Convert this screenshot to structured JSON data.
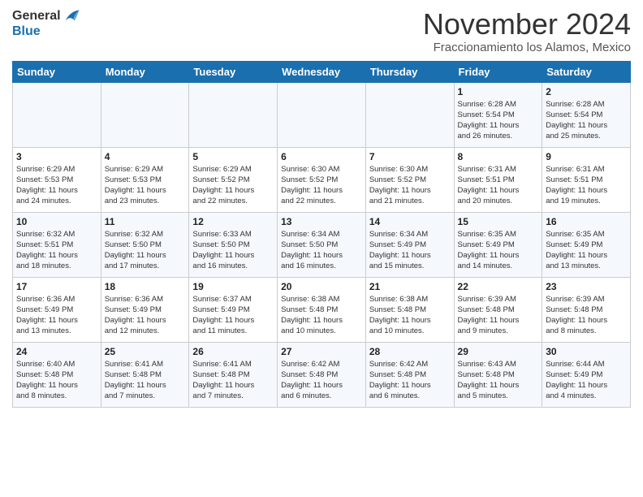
{
  "logo": {
    "general": "General",
    "blue": "Blue"
  },
  "header": {
    "month": "November 2024",
    "location": "Fraccionamiento los Alamos, Mexico"
  },
  "weekdays": [
    "Sunday",
    "Monday",
    "Tuesday",
    "Wednesday",
    "Thursday",
    "Friday",
    "Saturday"
  ],
  "weeks": [
    [
      {
        "day": "",
        "info": ""
      },
      {
        "day": "",
        "info": ""
      },
      {
        "day": "",
        "info": ""
      },
      {
        "day": "",
        "info": ""
      },
      {
        "day": "",
        "info": ""
      },
      {
        "day": "1",
        "info": "Sunrise: 6:28 AM\nSunset: 5:54 PM\nDaylight: 11 hours\nand 26 minutes."
      },
      {
        "day": "2",
        "info": "Sunrise: 6:28 AM\nSunset: 5:54 PM\nDaylight: 11 hours\nand 25 minutes."
      }
    ],
    [
      {
        "day": "3",
        "info": "Sunrise: 6:29 AM\nSunset: 5:53 PM\nDaylight: 11 hours\nand 24 minutes."
      },
      {
        "day": "4",
        "info": "Sunrise: 6:29 AM\nSunset: 5:53 PM\nDaylight: 11 hours\nand 23 minutes."
      },
      {
        "day": "5",
        "info": "Sunrise: 6:29 AM\nSunset: 5:52 PM\nDaylight: 11 hours\nand 22 minutes."
      },
      {
        "day": "6",
        "info": "Sunrise: 6:30 AM\nSunset: 5:52 PM\nDaylight: 11 hours\nand 22 minutes."
      },
      {
        "day": "7",
        "info": "Sunrise: 6:30 AM\nSunset: 5:52 PM\nDaylight: 11 hours\nand 21 minutes."
      },
      {
        "day": "8",
        "info": "Sunrise: 6:31 AM\nSunset: 5:51 PM\nDaylight: 11 hours\nand 20 minutes."
      },
      {
        "day": "9",
        "info": "Sunrise: 6:31 AM\nSunset: 5:51 PM\nDaylight: 11 hours\nand 19 minutes."
      }
    ],
    [
      {
        "day": "10",
        "info": "Sunrise: 6:32 AM\nSunset: 5:51 PM\nDaylight: 11 hours\nand 18 minutes."
      },
      {
        "day": "11",
        "info": "Sunrise: 6:32 AM\nSunset: 5:50 PM\nDaylight: 11 hours\nand 17 minutes."
      },
      {
        "day": "12",
        "info": "Sunrise: 6:33 AM\nSunset: 5:50 PM\nDaylight: 11 hours\nand 16 minutes."
      },
      {
        "day": "13",
        "info": "Sunrise: 6:34 AM\nSunset: 5:50 PM\nDaylight: 11 hours\nand 16 minutes."
      },
      {
        "day": "14",
        "info": "Sunrise: 6:34 AM\nSunset: 5:49 PM\nDaylight: 11 hours\nand 15 minutes."
      },
      {
        "day": "15",
        "info": "Sunrise: 6:35 AM\nSunset: 5:49 PM\nDaylight: 11 hours\nand 14 minutes."
      },
      {
        "day": "16",
        "info": "Sunrise: 6:35 AM\nSunset: 5:49 PM\nDaylight: 11 hours\nand 13 minutes."
      }
    ],
    [
      {
        "day": "17",
        "info": "Sunrise: 6:36 AM\nSunset: 5:49 PM\nDaylight: 11 hours\nand 13 minutes."
      },
      {
        "day": "18",
        "info": "Sunrise: 6:36 AM\nSunset: 5:49 PM\nDaylight: 11 hours\nand 12 minutes."
      },
      {
        "day": "19",
        "info": "Sunrise: 6:37 AM\nSunset: 5:49 PM\nDaylight: 11 hours\nand 11 minutes."
      },
      {
        "day": "20",
        "info": "Sunrise: 6:38 AM\nSunset: 5:48 PM\nDaylight: 11 hours\nand 10 minutes."
      },
      {
        "day": "21",
        "info": "Sunrise: 6:38 AM\nSunset: 5:48 PM\nDaylight: 11 hours\nand 10 minutes."
      },
      {
        "day": "22",
        "info": "Sunrise: 6:39 AM\nSunset: 5:48 PM\nDaylight: 11 hours\nand 9 minutes."
      },
      {
        "day": "23",
        "info": "Sunrise: 6:39 AM\nSunset: 5:48 PM\nDaylight: 11 hours\nand 8 minutes."
      }
    ],
    [
      {
        "day": "24",
        "info": "Sunrise: 6:40 AM\nSunset: 5:48 PM\nDaylight: 11 hours\nand 8 minutes."
      },
      {
        "day": "25",
        "info": "Sunrise: 6:41 AM\nSunset: 5:48 PM\nDaylight: 11 hours\nand 7 minutes."
      },
      {
        "day": "26",
        "info": "Sunrise: 6:41 AM\nSunset: 5:48 PM\nDaylight: 11 hours\nand 7 minutes."
      },
      {
        "day": "27",
        "info": "Sunrise: 6:42 AM\nSunset: 5:48 PM\nDaylight: 11 hours\nand 6 minutes."
      },
      {
        "day": "28",
        "info": "Sunrise: 6:42 AM\nSunset: 5:48 PM\nDaylight: 11 hours\nand 6 minutes."
      },
      {
        "day": "29",
        "info": "Sunrise: 6:43 AM\nSunset: 5:48 PM\nDaylight: 11 hours\nand 5 minutes."
      },
      {
        "day": "30",
        "info": "Sunrise: 6:44 AM\nSunset: 5:49 PM\nDaylight: 11 hours\nand 4 minutes."
      }
    ]
  ]
}
